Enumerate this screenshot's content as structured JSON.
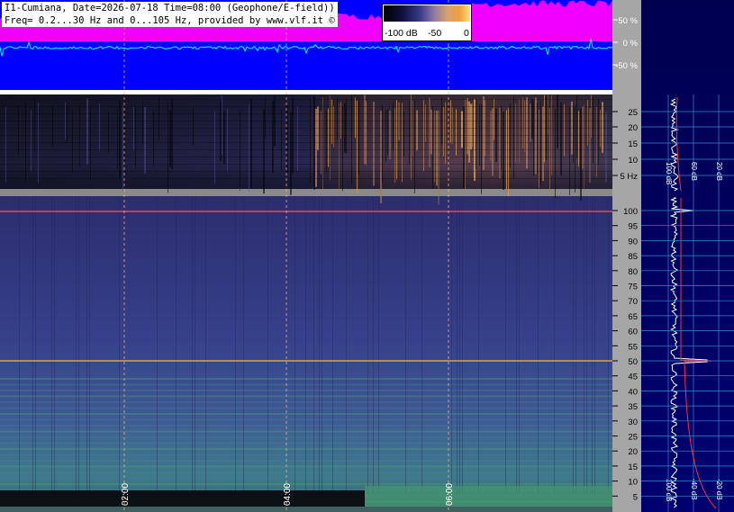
{
  "header": {
    "line1": "I1-Cumiana, Date=2026-07-18 Time=08:00 (Geophone/E-field))",
    "line2": "Freq= 0.2...30 Hz and 0...105 Hz, provided by www.vlf.it ©"
  },
  "colorbar": {
    "labels": [
      "-100 dB",
      "-50",
      "0"
    ]
  },
  "waveform_axis": [
    "50 %",
    "0 %",
    "-50 %"
  ],
  "time_marks": [
    "02:00",
    "04:00",
    "06:00"
  ],
  "low_freq_axis": [
    "25",
    "20",
    "15",
    "10",
    "5 Hz"
  ],
  "high_freq_axis": [
    "100",
    "95",
    "90",
    "85",
    "80",
    "75",
    "70",
    "65",
    "60",
    "55",
    "50",
    "45",
    "40",
    "35",
    "30",
    "25",
    "20",
    "15",
    "10",
    "5"
  ],
  "profile_labels": {
    "top": [
      "100 dB",
      "60 dB",
      "20 dB"
    ],
    "bottom": [
      "100 dB",
      "-40 dB",
      "-20 dB"
    ]
  },
  "colors": {
    "waveform_bg": "#0000ff",
    "envelope": "#ff00ff",
    "trace": "#00ffff",
    "axis_bg": "#a6a6a6",
    "side_bg": "#000060",
    "marker_line": "#ff4040"
  },
  "icons": {
    "copyright": "copyright-icon"
  }
}
